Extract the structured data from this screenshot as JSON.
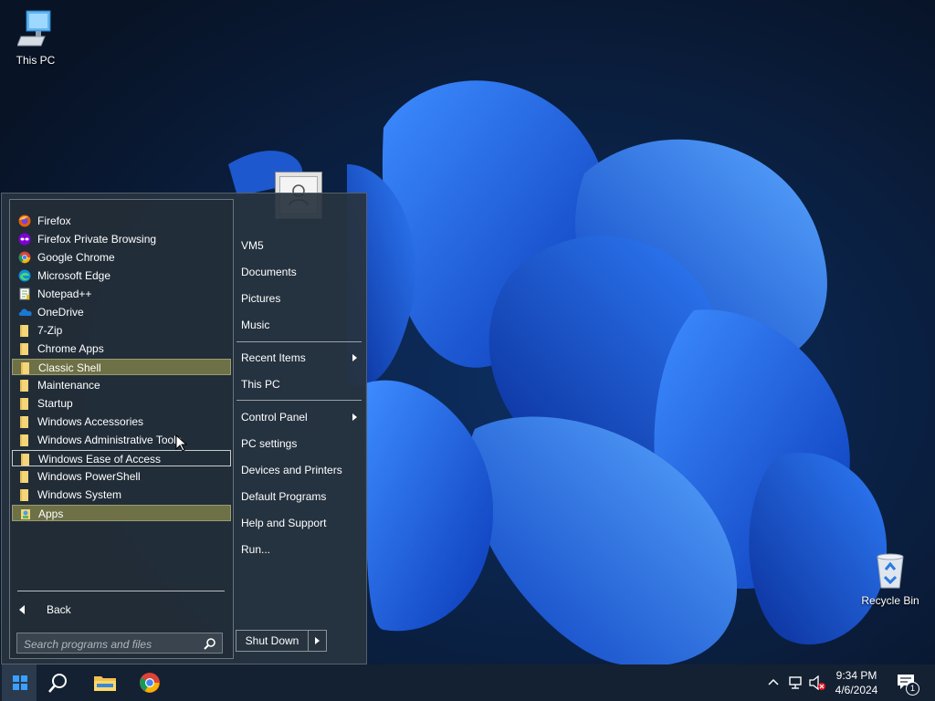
{
  "desktop": {
    "icons": [
      {
        "label": "This PC",
        "icon": "computer-icon"
      },
      {
        "label": "Recycle Bin",
        "icon": "recycle-bin-icon"
      }
    ]
  },
  "start_menu": {
    "programs": [
      {
        "label": "Firefox",
        "icon": "firefox-icon"
      },
      {
        "label": "Firefox Private Browsing",
        "icon": "firefox-private-icon"
      },
      {
        "label": "Google Chrome",
        "icon": "chrome-icon"
      },
      {
        "label": "Microsoft Edge",
        "icon": "edge-icon"
      },
      {
        "label": "Notepad++",
        "icon": "notepadpp-icon"
      },
      {
        "label": "OneDrive",
        "icon": "onedrive-icon"
      },
      {
        "label": "7-Zip",
        "icon": "folder-icon"
      },
      {
        "label": "Chrome Apps",
        "icon": "folder-icon"
      },
      {
        "label": "Classic Shell",
        "icon": "folder-icon",
        "state": "highlighted"
      },
      {
        "label": "Maintenance",
        "icon": "folder-icon"
      },
      {
        "label": "Startup",
        "icon": "folder-icon"
      },
      {
        "label": "Windows Accessories",
        "icon": "folder-icon"
      },
      {
        "label": "Windows Administrative Tools",
        "icon": "folder-icon"
      },
      {
        "label": "Windows Ease of Access",
        "icon": "folder-icon",
        "state": "focused"
      },
      {
        "label": "Windows PowerShell",
        "icon": "folder-icon"
      },
      {
        "label": "Windows System",
        "icon": "folder-icon"
      },
      {
        "label": "Apps",
        "icon": "apps-icon",
        "state": "highlighted"
      }
    ],
    "back_label": "Back",
    "search_placeholder": "Search programs and files",
    "right_items": {
      "vm5": "VM5",
      "documents": "Documents",
      "pictures": "Pictures",
      "music": "Music",
      "recent_items": "Recent Items",
      "this_pc": "This PC",
      "control_panel": "Control Panel",
      "pc_settings": "PC settings",
      "devices_printers": "Devices and Printers",
      "default_programs": "Default Programs",
      "help_support": "Help and Support",
      "run": "Run..."
    },
    "shutdown_label": "Shut Down"
  },
  "taskbar": {
    "pinned": [
      "start-icon",
      "search-icon",
      "file-explorer-icon",
      "chrome-icon"
    ],
    "tray": {
      "time": "9:34 PM",
      "date": "4/6/2024",
      "notification_count": "1"
    }
  },
  "colors": {
    "highlight": "#6e7046",
    "menu_bg": "#283440",
    "taskbar": "#142132"
  }
}
